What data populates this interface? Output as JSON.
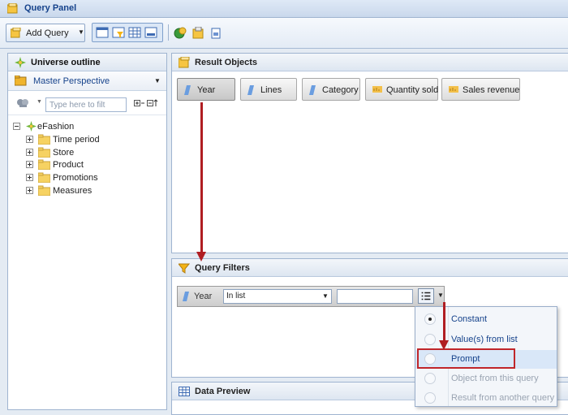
{
  "window": {
    "title": "Query Panel"
  },
  "toolbar": {
    "add_query_label": "Add Query"
  },
  "universe_outline": {
    "title": "Universe outline",
    "perspective": "Master Perspective",
    "search_placeholder": "Type here to filt",
    "tree": {
      "root": "eFashion",
      "children": [
        "Time period",
        "Store",
        "Product",
        "Promotions",
        "Measures"
      ]
    }
  },
  "result_objects": {
    "title": "Result Objects",
    "items": [
      {
        "label": "Year",
        "kind": "dimension",
        "selected": true
      },
      {
        "label": "Lines",
        "kind": "dimension",
        "selected": false
      },
      {
        "label": "Category",
        "kind": "dimension",
        "selected": false
      },
      {
        "label": "Quantity sold",
        "kind": "measure",
        "selected": false
      },
      {
        "label": "Sales revenue",
        "kind": "measure",
        "selected": false
      }
    ]
  },
  "query_filters": {
    "title": "Query Filters",
    "filter": {
      "object": "Year",
      "operator": "In list",
      "value": ""
    }
  },
  "data_preview": {
    "title": "Data Preview"
  },
  "operand_menu": {
    "items": [
      {
        "label": "Constant",
        "enabled": true,
        "selected": true
      },
      {
        "label": "Value(s) from list",
        "enabled": true,
        "selected": false
      },
      {
        "label": "Prompt",
        "enabled": true,
        "selected": false,
        "highlighted": true
      },
      {
        "label": "Object from this query",
        "enabled": false,
        "selected": false
      },
      {
        "label": "Result from another query",
        "enabled": false,
        "selected": false
      }
    ]
  },
  "colors": {
    "annotation": "#b01e22",
    "accent_text": "#15428b"
  }
}
